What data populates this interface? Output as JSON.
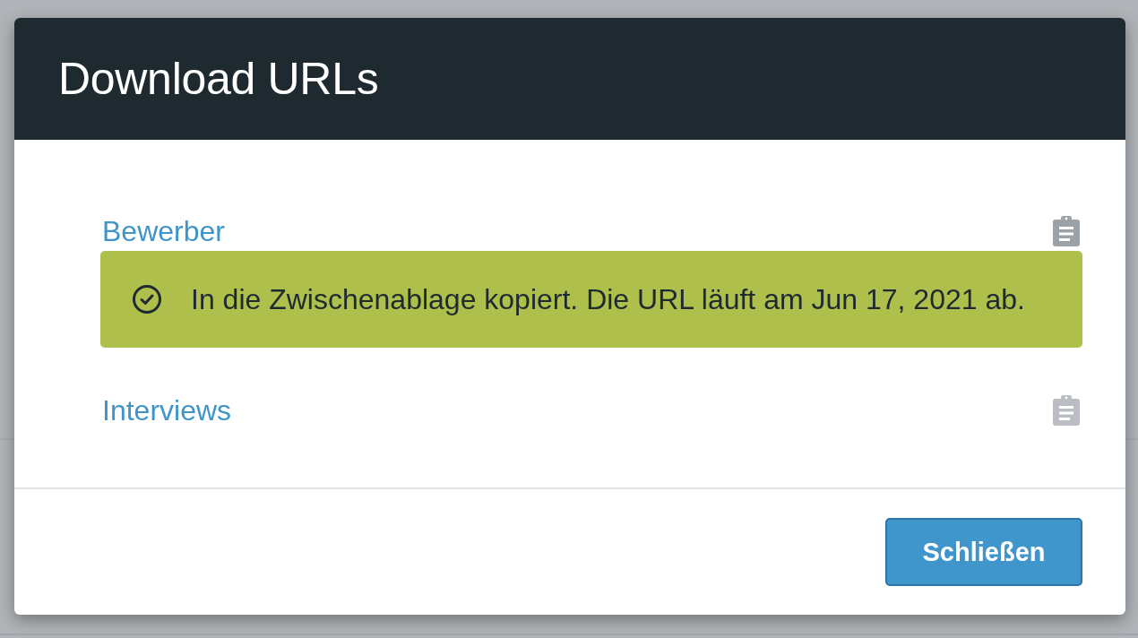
{
  "dialog": {
    "title": "Download URLs",
    "items": [
      {
        "label": "Bewerber",
        "copy_active": true,
        "alert": {
          "kind": "success",
          "message": "In die Zwischenablage kopiert. Die URL läuft am Jun 17, 2021 ab."
        }
      },
      {
        "label": "Interviews",
        "copy_active": false
      }
    ],
    "buttons": [
      {
        "label": "Schließen",
        "kind": "primary"
      }
    ]
  }
}
